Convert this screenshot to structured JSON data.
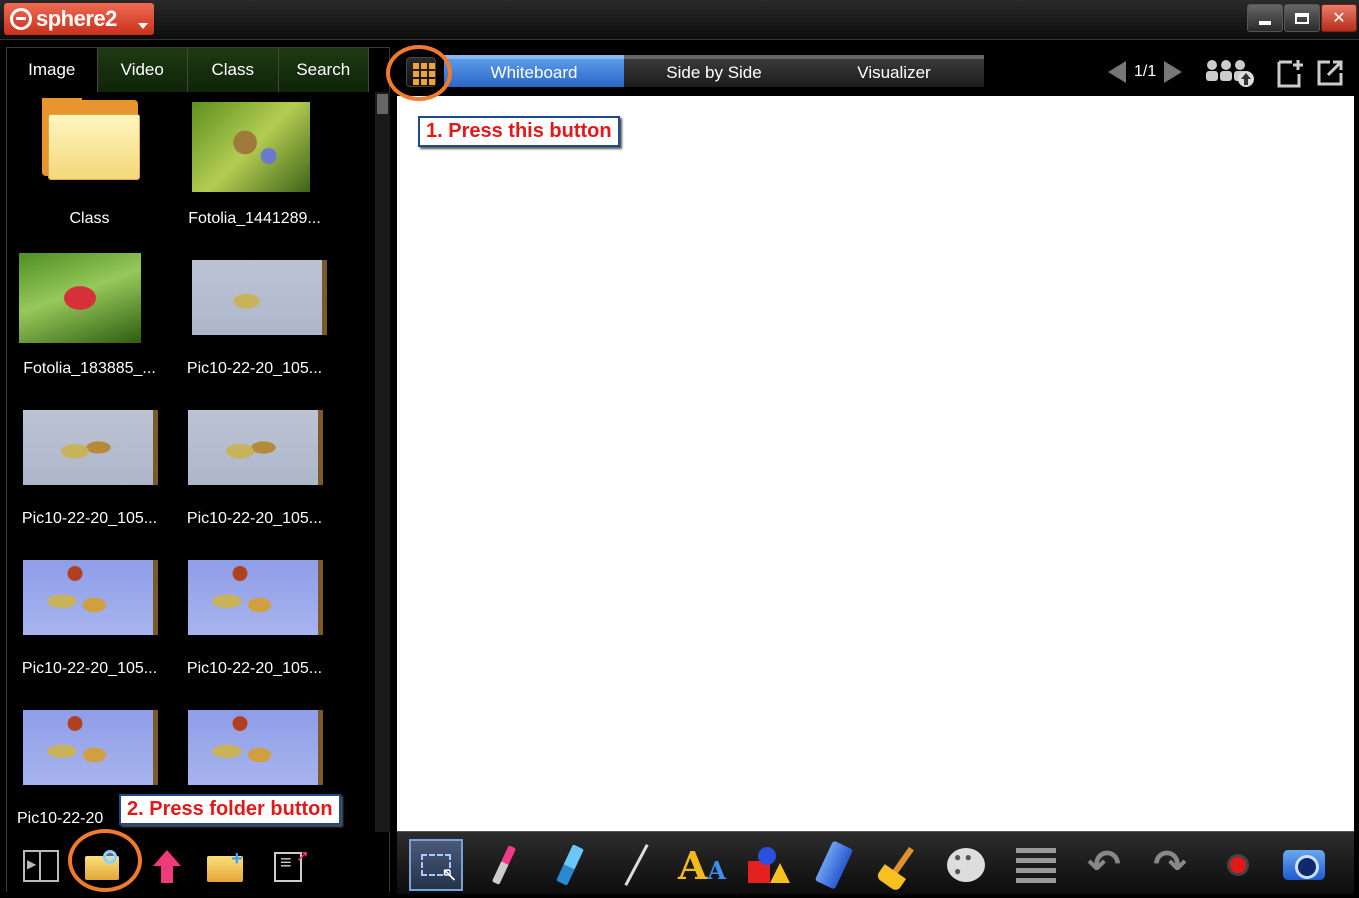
{
  "app": {
    "logo_text": "sphere2",
    "window_controls": [
      "minimize-icon",
      "maximize-icon",
      "close-icon"
    ],
    "close_glyph": "✕"
  },
  "left_panel": {
    "tabs": [
      {
        "label": "Image",
        "active": true
      },
      {
        "label": "Video",
        "active": false
      },
      {
        "label": "Class",
        "active": false
      },
      {
        "label": "Search",
        "active": false
      }
    ],
    "items": [
      {
        "label": "Class",
        "kind": "folder"
      },
      {
        "label": "Fotolia_1441289...",
        "kind": "photo"
      },
      {
        "label": "Fotolia_183885_...",
        "kind": "photo"
      },
      {
        "label": "Pic10-22-20_105...",
        "kind": "photo"
      },
      {
        "label": "Pic10-22-20_105...",
        "kind": "photo"
      },
      {
        "label": "Pic10-22-20_105...",
        "kind": "photo"
      },
      {
        "label": "Pic10-22-20_105...",
        "kind": "photo"
      },
      {
        "label": "Pic10-22-20_105...",
        "kind": "photo"
      },
      {
        "label": "Pic10-22-20",
        "kind": "photo"
      },
      {
        "label": "",
        "kind": "photo"
      }
    ],
    "bottom_icons": [
      "split-view-icon",
      "open-folder-icon",
      "upload-icon",
      "new-folder-icon",
      "list-export-icon"
    ]
  },
  "annotations": {
    "step1": "1. Press this button",
    "step2": "2. Press folder button",
    "ring_color": "#f07a2e",
    "text_color": "#e01a1a"
  },
  "main": {
    "mode_tabs": [
      {
        "label": "Whiteboard",
        "active": true
      },
      {
        "label": "Side by Side",
        "active": false
      },
      {
        "label": "Visualizer",
        "active": false
      }
    ],
    "page_indicator": "1/1",
    "top_icons": [
      "grid-menu-icon",
      "prev-page-icon",
      "next-page-icon",
      "share-users-icon",
      "new-page-icon",
      "export-icon"
    ],
    "tools": [
      "selection-tool-icon",
      "pen-tool-icon",
      "highlighter-tool-icon",
      "line-tool-icon",
      "text-tool-icon",
      "shapes-tool-icon",
      "eraser-tool-icon",
      "clear-broom-icon",
      "color-palette-icon",
      "line-width-icon",
      "undo-icon",
      "redo-icon",
      "record-icon",
      "camera-icon"
    ]
  },
  "colors": {
    "accent_blue": "#2a67c8",
    "tab_green": "#1f3a12",
    "logo_red": "#d8402a"
  }
}
